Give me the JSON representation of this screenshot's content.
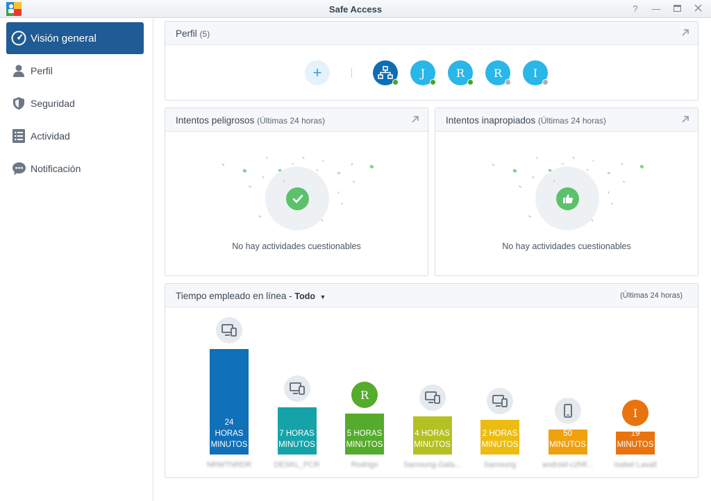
{
  "window": {
    "title": "Safe Access"
  },
  "sidebar": {
    "items": [
      {
        "label": "Visión general",
        "icon": "dashboard-icon",
        "active": true
      },
      {
        "label": "Perfil",
        "icon": "person-icon"
      },
      {
        "label": "Seguridad",
        "icon": "shield-icon"
      },
      {
        "label": "Actividad",
        "icon": "list-icon"
      },
      {
        "label": "Notificación",
        "icon": "chat-bubble-icon"
      }
    ]
  },
  "profiles": {
    "title": "Perfil",
    "count": "(5)",
    "add_label": "+",
    "avatars": [
      {
        "letter": "",
        "kind": "network",
        "status": "online"
      },
      {
        "letter": "J",
        "status": "online"
      },
      {
        "letter": "R",
        "status": "online"
      },
      {
        "letter": "R",
        "status": "offline"
      },
      {
        "letter": "I",
        "status": "offline"
      }
    ]
  },
  "dangerous": {
    "title": "Intentos peligrosos",
    "subtitle": "(Últimas 24 horas)",
    "empty": "No hay actividades cuestionables",
    "icon": "check-icon"
  },
  "inappropriate": {
    "title": "Intentos inapropiados",
    "subtitle": "(Últimas 24 horas)",
    "empty": "No hay actividades cuestionables",
    "icon": "thumbs-up-icon"
  },
  "online_time": {
    "title": "Tiempo empleado en línea -",
    "filter": "Todo",
    "range": "(Últimas 24 horas)",
    "bars": [
      {
        "label_lines": [
          "24",
          "HORAS",
          "MINUTOS"
        ],
        "color": "#1070b8",
        "level": 1.0,
        "icon": "devices-icon",
        "name": "NRWTNRDR"
      },
      {
        "label_lines": [
          "7 HORAS",
          "MINUTOS"
        ],
        "color": "#16a3a8",
        "level": 0.45,
        "icon": "devices-icon",
        "name": "DESKL_PCR"
      },
      {
        "label_lines": [
          "5 HORAS",
          "MINUTOS"
        ],
        "color": "#55ab2c",
        "level": 0.39,
        "avatar": "R",
        "avatar_color": "#55ab2c",
        "name": "Rodrigo"
      },
      {
        "label_lines": [
          "4 HORAS",
          "MINUTOS"
        ],
        "color": "#b5c122",
        "level": 0.36,
        "icon": "devices-icon",
        "name": "Samsung-Gala..."
      },
      {
        "label_lines": [
          "2 HORAS",
          "MINUTOS"
        ],
        "color": "#ecbc12",
        "level": 0.33,
        "icon": "devices-icon",
        "name": "Samsung"
      },
      {
        "label_lines": [
          "50",
          "MINUTOS"
        ],
        "color": "#f0a10f",
        "level": 0.24,
        "icon": "phone-icon",
        "name": "android-c2f4f..."
      },
      {
        "label_lines": [
          "19",
          "MINUTOS"
        ],
        "color": "#e8730f",
        "level": 0.22,
        "avatar": "I",
        "avatar_color": "#e8730f",
        "name": "Isabel Lasall"
      }
    ]
  }
}
